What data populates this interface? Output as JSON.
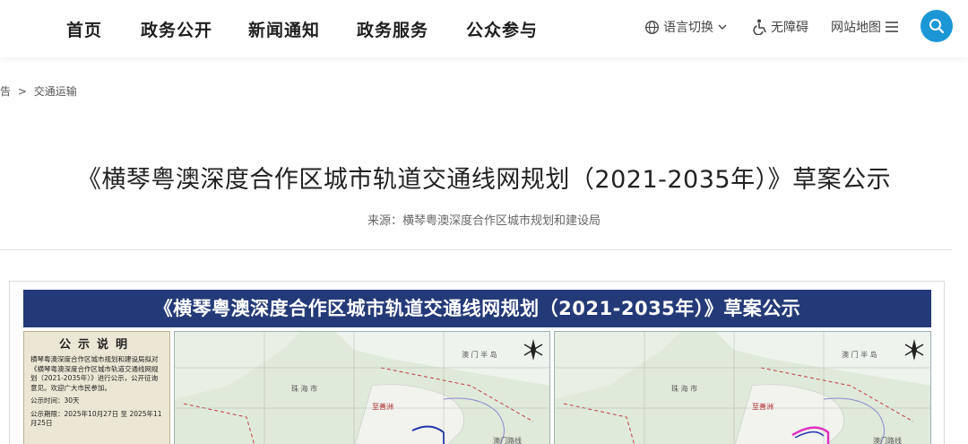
{
  "nav": {
    "items": [
      "首页",
      "政务公开",
      "新闻通知",
      "政务服务",
      "公众参与"
    ]
  },
  "utilities": {
    "language": "语言切换",
    "accessibility": "无障碍",
    "sitemap": "网站地图"
  },
  "breadcrumb": {
    "items": [
      "告",
      "交通运输"
    ],
    "separator": ">"
  },
  "article": {
    "title": "《横琴粤澳深度合作区城市轨道交通线网规划（2021-2035年）》草案公示",
    "source": "来源：横琴粤澳深度合作区城市规划和建设局"
  },
  "poster": {
    "banner": "《横琴粤澳深度合作区城市轨道交通线网规划（2021-2035年）》草案公示",
    "notice_heading": "公示说明",
    "notice_text": "横琴粤澳深度合作区城市规划和建设局拟对《横琴粤澳深度合作区城市轨道交通线网规划（2021-2035年）》进行公示，公开征询意见。欢迎广大市民参加。",
    "notice_period": "公示时间：30天",
    "notice_dates": "公示期限：2025年10月27日 至 2025年11月25日",
    "map_labels": {
      "macau_peninsula": "澳 门 半 岛",
      "zhuhai": "珠 海 市",
      "macau_rail": "澳门路线",
      "zhiyuan": "至善洲"
    }
  },
  "colors": {
    "accent": "#1b97d6",
    "banner": "#243a78",
    "notice_bg": "#ece7d4",
    "map_bg": "#dbe9d4"
  }
}
